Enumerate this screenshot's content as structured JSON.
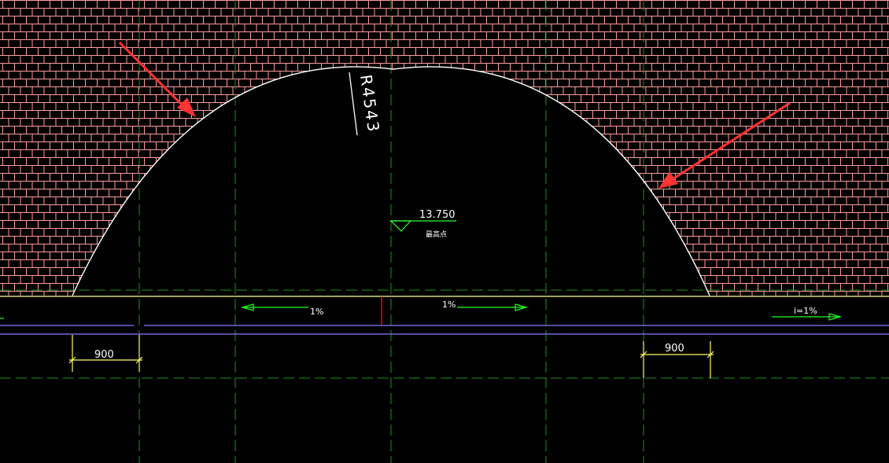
{
  "drawing": {
    "colors": {
      "background": "#000000",
      "hatch": "#ff9c9c",
      "arch": "#ffffff",
      "grid": "#1f8f1f",
      "slope": "#22ff22",
      "dimension": "#ffff66",
      "level_symbol": "#33ff33",
      "pipe": "#8a7cff",
      "marker": "#ff0000",
      "arrow": "#ff3333",
      "text": "#ffffff"
    },
    "arch_radius_label": "R4543",
    "elevation": {
      "value": "13.750",
      "note": "最高点"
    },
    "slopes": [
      {
        "label": "1%",
        "direction": "left"
      },
      {
        "label": "1%",
        "direction": "right"
      },
      {
        "label": "i=1%",
        "direction": "right"
      }
    ],
    "dimensions": [
      {
        "label": "900",
        "side": "left"
      },
      {
        "label": "900",
        "side": "right"
      }
    ],
    "annotation_arrows": [
      "left",
      "right"
    ]
  }
}
